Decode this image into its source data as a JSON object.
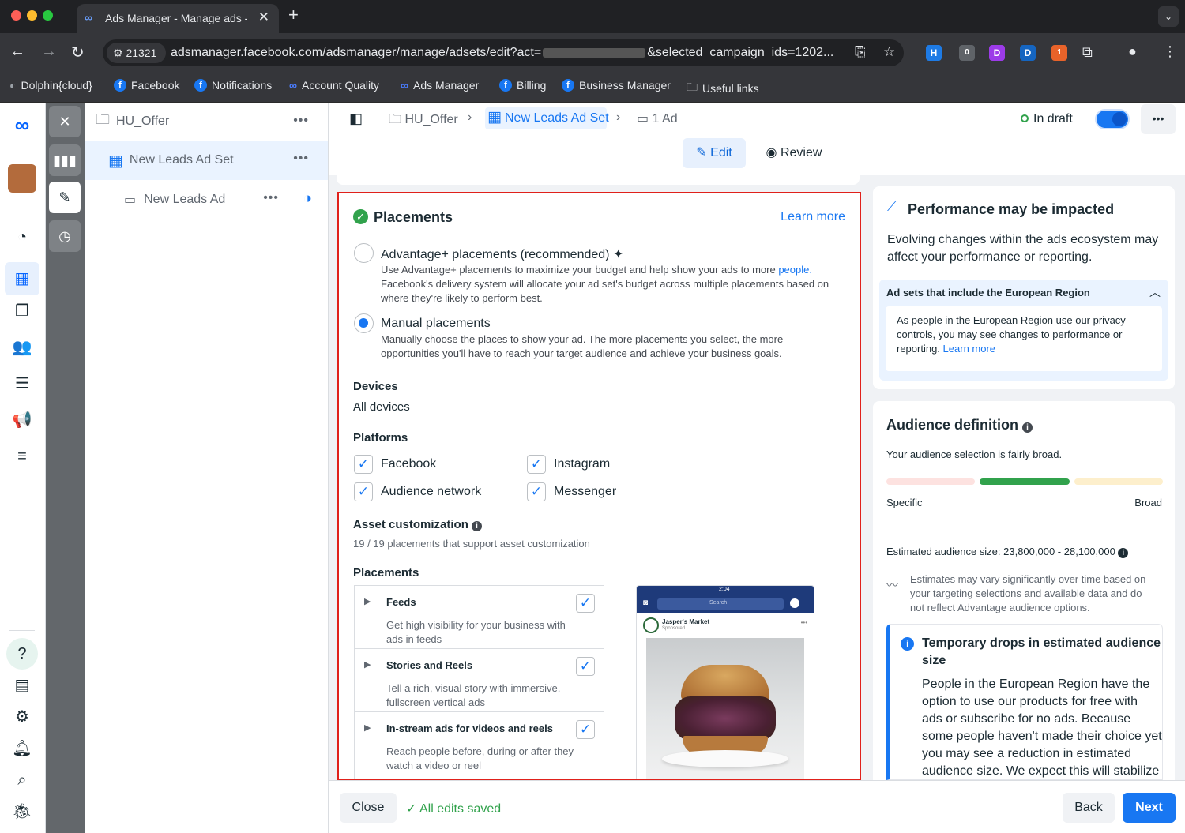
{
  "browser": {
    "tab_title": "Ads Manager - Manage ads -",
    "tab_close": "✕",
    "new_tab": "+",
    "site_info": "21321",
    "url_start": "adsmanager.facebook.com/adsmanager/manage/adsets/edit?act=",
    "url_end": "&selected_campaign_ids=1202...",
    "bookmarks": [
      "Dolphin{cloud}",
      "Facebook",
      "Notifications",
      "Account Quality",
      "Ads Manager",
      "Billing",
      "Business Manager",
      "Useful links"
    ],
    "ext_badge_1": "0",
    "ext_badge_2": "1"
  },
  "tree": {
    "campaign": "HU_Offer",
    "adset": "New Leads Ad Set",
    "ad": "New Leads Ad",
    "more": "•••"
  },
  "header": {
    "crumb_campaign": "HU_Offer",
    "crumb_adset": "New Leads Ad Set",
    "crumb_ad": "1 Ad",
    "status": "In draft",
    "edit": "Edit",
    "review": "Review",
    "more": "•••"
  },
  "placements": {
    "title": "Placements",
    "learn_more": "Learn more",
    "advantage_label": "Advantage+ placements (recommended)",
    "advantage_desc_1": "Use Advantage+ placements to maximize your budget and help show your ads to more",
    "advantage_desc_link": "people.",
    "advantage_desc_2": "Facebook's delivery system will allocate your ad set's budget across multiple placements based on",
    "advantage_desc_3": "where they're likely to perform best.",
    "manual_label": "Manual placements",
    "manual_desc_1": "Manually choose the places to show your ad. The more placements you select, the more",
    "manual_desc_2": "opportunities you'll have to reach your target audience and achieve your business goals.",
    "devices_title": "Devices",
    "devices_value": "All devices",
    "platforms_title": "Platforms",
    "platforms": [
      "Facebook",
      "Instagram",
      "Audience network",
      "Messenger"
    ],
    "asset_title": "Asset customization",
    "asset_desc": "19 / 19 placements that support asset customization",
    "placements_title": "Placements",
    "items": [
      {
        "title": "Feeds",
        "desc_1": "Get high visibility for your business with",
        "desc_2": "ads in feeds"
      },
      {
        "title": "Stories and Reels",
        "desc_1": "Tell a rich, visual story with immersive,",
        "desc_2": "fullscreen vertical ads"
      },
      {
        "title": "In-stream ads for videos and reels",
        "desc_1": "Reach people before, during or after they",
        "desc_2": "watch a video or reel"
      }
    ],
    "preview_time": "2:04",
    "preview_search": "Search",
    "preview_page": "Jasper's Market",
    "preview_sponsored": "Sponsored · ",
    "preview_dots": "•••"
  },
  "performance": {
    "title": "Performance may be impacted",
    "desc_1": "Evolving changes within the ads ecosystem may",
    "desc_2": "affect your performance or reporting.",
    "eu_title": "Ad sets that include the European Region",
    "eu_desc_1": "As people in the European Region use our privacy",
    "eu_desc_2": "controls, you may see changes to performance or",
    "eu_desc_3": "reporting.",
    "eu_link": "Learn more"
  },
  "audience": {
    "title": "Audience definition",
    "desc": "Your audience selection is fairly broad.",
    "specific": "Specific",
    "broad": "Broad",
    "size_label": "Estimated audience size: 23,800,000 - 28,100,000",
    "estimate_1": "Estimates may vary significantly over time based on",
    "estimate_2": "your targeting selections and available data and do",
    "estimate_3": "not reflect Advantage audience options.",
    "temp_title_1": "Temporary drops in estimated audience",
    "temp_title_2": "size",
    "temp_1": "People in the European Region have the",
    "temp_2": "option to use our products for free with",
    "temp_3": "ads or subscribe for no ads. Because",
    "temp_4": "some people haven't made their choice yet",
    "temp_5": "you may see a reduction in estimated",
    "temp_6": "audience size. We expect this will stabilize"
  },
  "footer": {
    "close": "Close",
    "saved": "All edits saved",
    "back": "Back",
    "next": "Next"
  },
  "colors": {
    "accent": "#1877f2",
    "highlight_border": "#e0211b",
    "success": "#31a24c"
  }
}
